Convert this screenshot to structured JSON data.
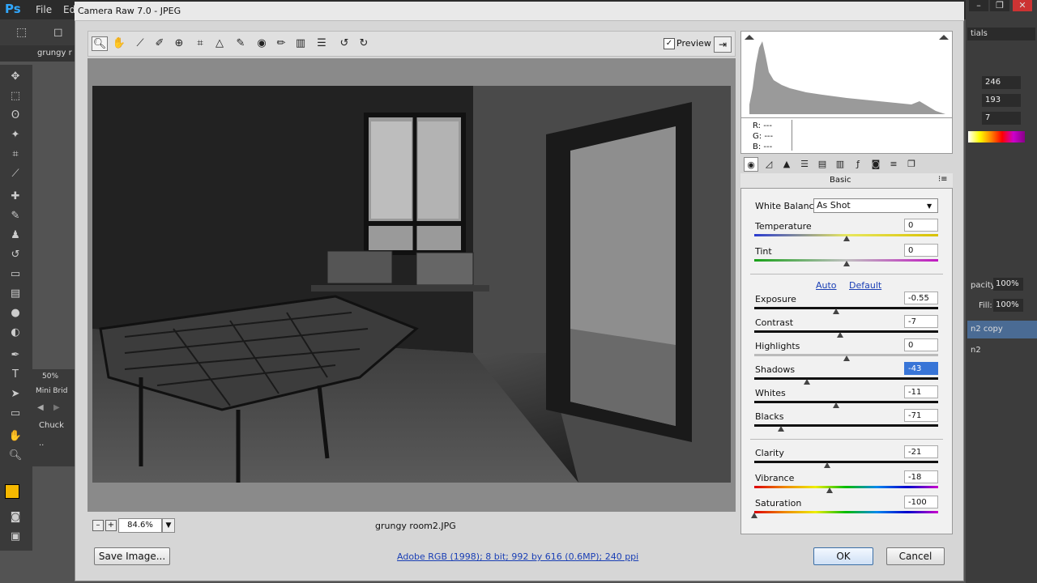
{
  "ps": {
    "logo": "Ps",
    "menu": [
      "File",
      "Ed"
    ],
    "doc_tab": "grungy r",
    "zoom_pct": "50%",
    "mini_bridge": "Mini Brid",
    "chuck_label": "Chuck",
    "ellipsis": "..",
    "right": {
      "essentials": "tials",
      "color_values": [
        "246",
        "193",
        "7"
      ],
      "opacity_label": "pacity:",
      "opacity_value": "100%",
      "fill_label": "Fill:",
      "fill_value": "100%",
      "layers": [
        "n2 copy",
        "n2"
      ]
    },
    "fg_color": "#f5b800"
  },
  "dialog": {
    "title": "Camera Raw 7.0  -  JPEG",
    "preview_label": "Preview",
    "preview_checked": true,
    "zoom_value": "84.6%",
    "filename": "grungy room2.JPG",
    "save_label": "Save Image...",
    "workflow_text": "Adobe RGB (1998); 8 bit; 992 by 616 (0.6MP); 240 ppi",
    "ok_label": "OK",
    "cancel_label": "Cancel",
    "toolbar_icons": [
      "zoom-icon",
      "hand-icon",
      "white-balance-icon",
      "color-sampler-icon",
      "target-adjust-icon",
      "crop-icon",
      "straighten-icon",
      "spot-removal-icon",
      "red-eye-icon",
      "adjustment-brush-icon",
      "graduated-filter-icon",
      "preferences-icon",
      "rotate-ccw-icon",
      "rotate-cw-icon"
    ]
  },
  "rgb": {
    "r": "R:",
    "g": "G:",
    "b": "B:",
    "r_val": "---",
    "g_val": "---",
    "b_val": "---"
  },
  "panel": {
    "title": "Basic",
    "white_balance_label": "White Balance:",
    "white_balance_value": "As Shot",
    "auto_label": "Auto",
    "default_label": "Default",
    "sliders": [
      {
        "label": "Temperature",
        "value": "0",
        "position": 0.5
      },
      {
        "label": "Tint",
        "value": "0",
        "position": 0.5
      },
      {
        "label": "Exposure",
        "value": "-0.55",
        "position": 0.445
      },
      {
        "label": "Contrast",
        "value": "-7",
        "position": 0.465
      },
      {
        "label": "Highlights",
        "value": "0",
        "position": 0.5
      },
      {
        "label": "Shadows",
        "value": "-43",
        "position": 0.285
      },
      {
        "label": "Whites",
        "value": "-11",
        "position": 0.445
      },
      {
        "label": "Blacks",
        "value": "-71",
        "position": 0.145
      },
      {
        "label": "Clarity",
        "value": "-21",
        "position": 0.395
      },
      {
        "label": "Vibrance",
        "value": "-18",
        "position": 0.41
      },
      {
        "label": "Saturation",
        "value": "-100",
        "position": 0.0
      }
    ]
  }
}
